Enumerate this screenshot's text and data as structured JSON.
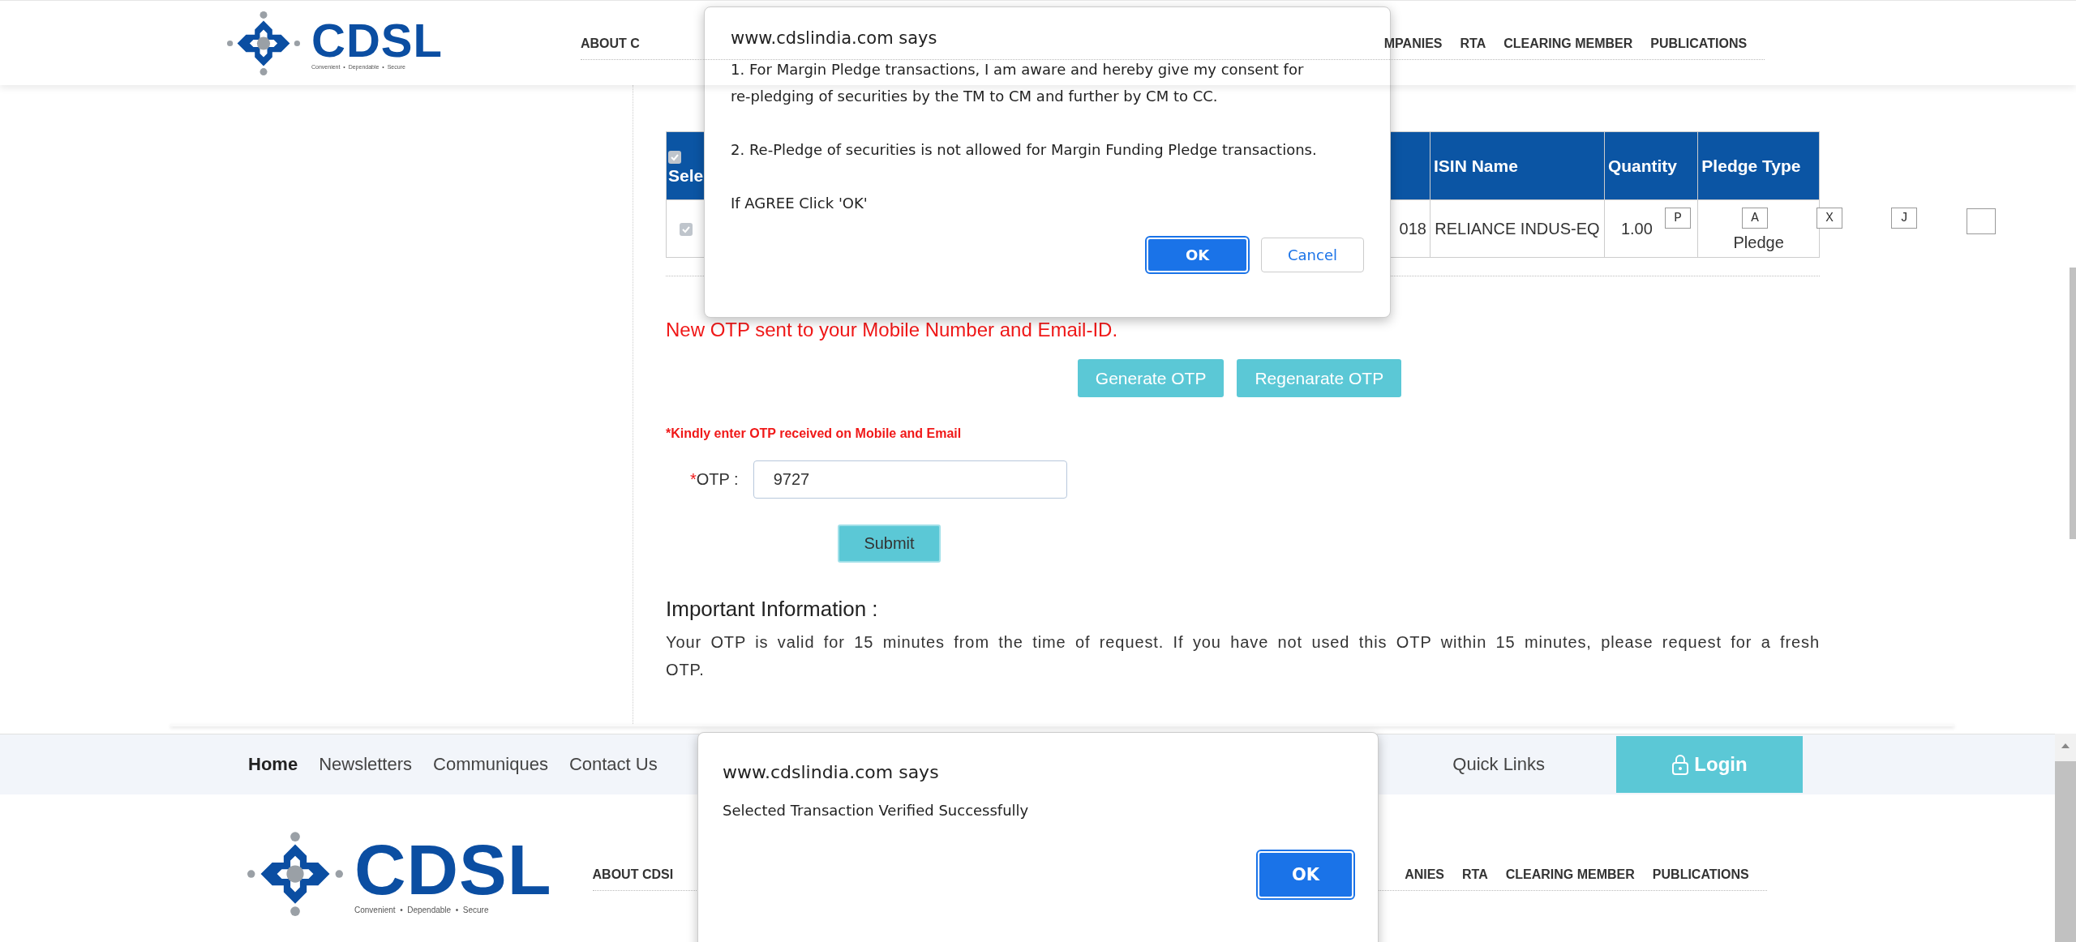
{
  "top_page": {
    "header": {
      "logo": {
        "name": "CDSL",
        "tagline": "Convenient  •  Dependable  •  Secure"
      },
      "nav": [
        "ABOUT C",
        "MPANIES",
        "RTA",
        "CLEARING MEMBER",
        "PUBLICATIONS"
      ]
    },
    "table": {
      "header_checkbox": {
        "checked": true
      },
      "columns": [
        "Sele",
        "ISIN Name",
        "Quantity",
        "Pledge Type"
      ],
      "rows": [
        {
          "checked": true,
          "cells": [
            "018",
            "RELIANCE INDUS-EQ",
            "1.00",
            "Pledge"
          ]
        }
      ]
    },
    "overlay_keys": [
      {
        "kind": "letter",
        "label": "P"
      },
      {
        "kind": "letter",
        "label": "A"
      },
      {
        "kind": "letter",
        "label": "X"
      },
      {
        "kind": "letter",
        "label": "J"
      },
      {
        "kind": "blank"
      }
    ],
    "otp_status": "New OTP sent to your Mobile Number and Email-ID.",
    "otp_buttons": [
      "Generate OTP",
      "Regenarate OTP"
    ],
    "otp_hint": "*Kindly enter OTP received on Mobile and Email",
    "otp_field": {
      "required_mark": "*",
      "label": "OTP :",
      "value": "9727"
    },
    "submit": "Submit",
    "info": {
      "title": "Important Information :",
      "text": "Your OTP is valid for 15 minutes from the time of request. If you have not used this OTP within 15 minutes, please request for a fresh OTP."
    }
  },
  "dialog_top": {
    "title": "www.cdslindia.com says",
    "paragraphs": [
      "1. For Margin Pledge transactions, I am aware and hereby give my consent for re-pledging of securities by the TM to CM and further by CM to CC.",
      "2. Re-Pledge of securities is not allowed for Margin Funding Pledge transactions.",
      "If AGREE Click 'OK'"
    ],
    "buttons": [
      "OK",
      "Cancel"
    ]
  },
  "bottom_page": {
    "footer_links": [
      {
        "label": "Home",
        "selected": true
      },
      {
        "label": "Newsletters",
        "selected": false
      },
      {
        "label": "Communiques",
        "selected": false
      },
      {
        "label": "Contact Us",
        "selected": false
      }
    ],
    "quick_links": "Quick Links",
    "login": "Login",
    "header": {
      "logo": {
        "name": "CDSL",
        "tagline": "Convenient  •  Dependable  •  Secure"
      },
      "nav": [
        "ABOUT CDSI",
        "ANIES",
        "RTA",
        "CLEARING MEMBER",
        "PUBLICATIONS"
      ]
    }
  },
  "dialog_bottom": {
    "title": "www.cdslindia.com says",
    "message": "Selected Transaction Verified Successfully",
    "buttons": [
      "OK"
    ]
  }
}
